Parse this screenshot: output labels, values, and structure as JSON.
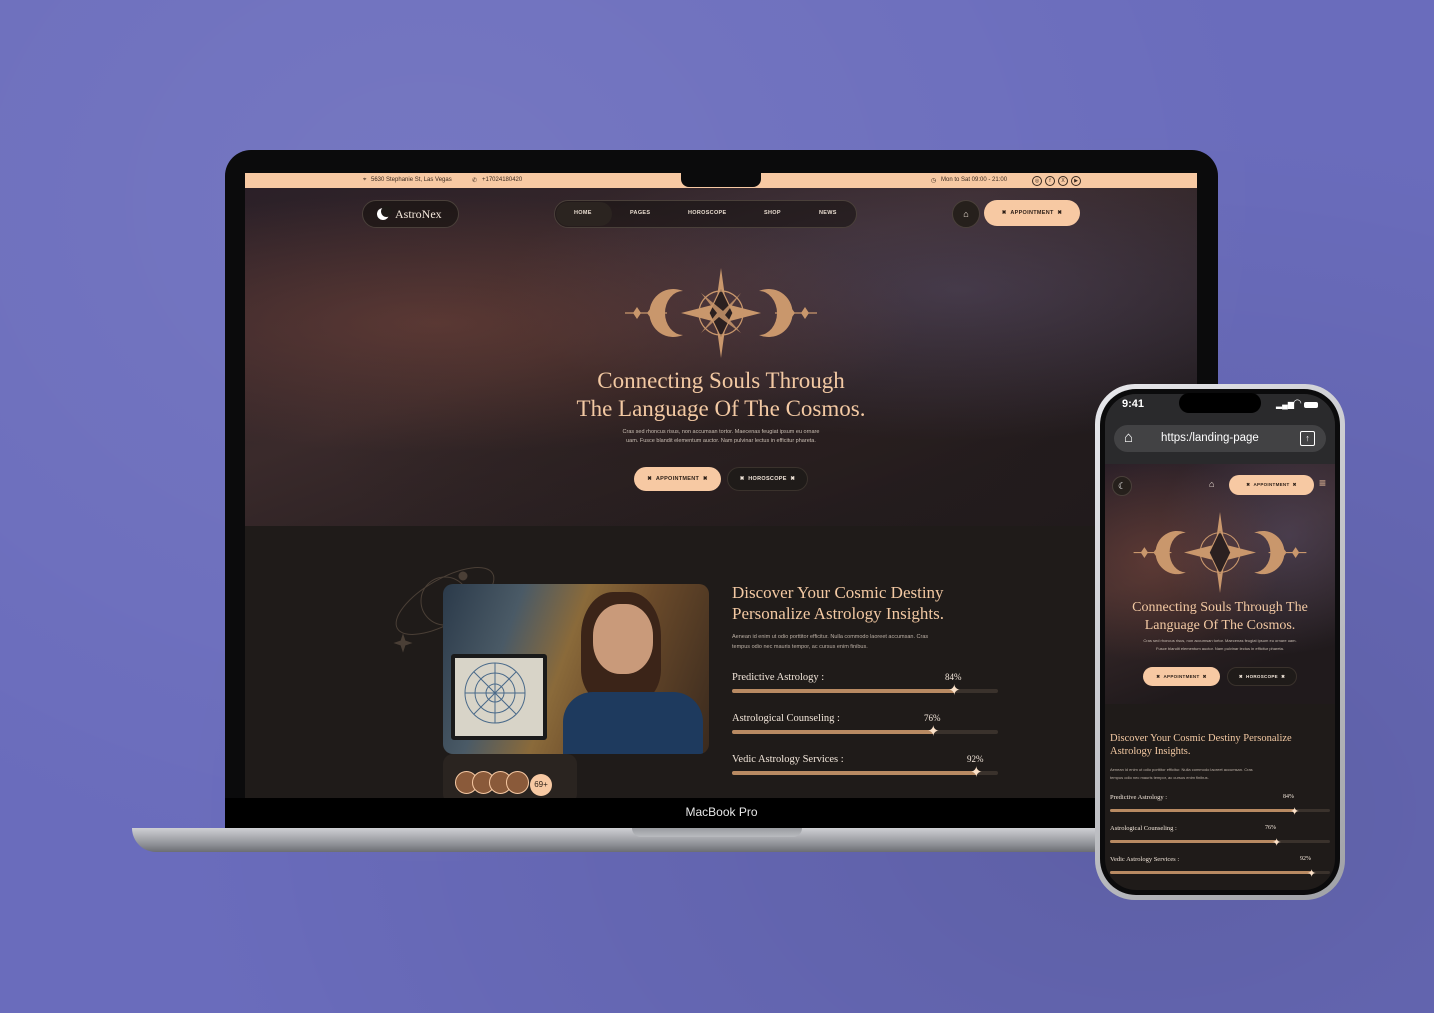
{
  "laptop": {
    "device_label": "MacBook Pro",
    "topbar": {
      "address": "5630 Stephanie St, Las Vegas",
      "phone": "+17024180420",
      "hours": "Mon to Sat 09:00 - 21:00",
      "social_icons": [
        "instagram-icon",
        "facebook-icon",
        "x-icon",
        "youtube-icon"
      ]
    },
    "header": {
      "brand": "AstroNex",
      "nav": [
        "HOME",
        "PAGES",
        "HOROSCOPE",
        "SHOP",
        "NEWS"
      ],
      "appointment": "APPOINTMENT"
    },
    "hero": {
      "title_line1": "Connecting Souls Through",
      "title_line2": "The Language Of The Cosmos.",
      "subtitle_line1": "Cras sed rhoncus risus, non accumsan tortor. Maecenas feugiat ipsum eu ornare",
      "subtitle_line2": "uam. Fusce blandit elementum auctor. Nam pulvinar lectus in efficitur phareta.",
      "btn_appointment": "APPOINTMENT",
      "btn_horoscope": "HOROSCOPE"
    },
    "about": {
      "title_line1": "Discover Your Cosmic Destiny",
      "title_line2": "Personalize Astrology Insights.",
      "para_line1": "Aenean id enim ut odio porttitor efficitur. Nulla commodo laoreet accumsan. Cras",
      "para_line2": "tempus odio nec mauris tempor, ac cursus enim finibus.",
      "avatar_count": "69+",
      "skills": [
        {
          "label": "Predictive Astrology :",
          "value": "84%",
          "percent": 84
        },
        {
          "label": "Astrological Counseling :",
          "value": "76%",
          "percent": 76
        },
        {
          "label": "Vedic Astrology Services :",
          "value": "92%",
          "percent": 92
        }
      ]
    }
  },
  "phone": {
    "time": "9:41",
    "url": "https:/landing-page",
    "appointment": "APPOINTMENT",
    "hero_title_line1": "Connecting Souls Through The",
    "hero_title_line2": "Language Of The Cosmos.",
    "hero_sub_line1": "Cras sed rhoncus risus, non accumsan tortor. Maecenas feugiat ipsum eu ornare uam.",
    "hero_sub_line2": "Fusce blandit elementum auctor. Nam pulvinar lectus in efficitur phareta.",
    "btn_appointment": "APPOINTMENT",
    "btn_horoscope": "HOROSCOPE",
    "about_title_line1": "Discover Your Cosmic Destiny Personalize",
    "about_title_line2": "Astrology Insights.",
    "about_para_line1": "Aenean id enim ut odio porttitor efficitur. Nulla commodo laoreet accumsan. Cras",
    "about_para_line2": "tempus odio nec mauris tempor, ac cursus enim finibus.",
    "skills": [
      {
        "label": "Predictive Astrology :",
        "value": "84%",
        "percent": 84
      },
      {
        "label": "Astrological Counseling :",
        "value": "76%",
        "percent": 76
      },
      {
        "label": "Vedic Astrology Services :",
        "value": "92%",
        "percent": 92
      }
    ]
  },
  "colors": {
    "background": "#6a6cbc",
    "accent": "#f7c9a3",
    "gold": "#c9976c",
    "dark": "#1f1b19"
  }
}
